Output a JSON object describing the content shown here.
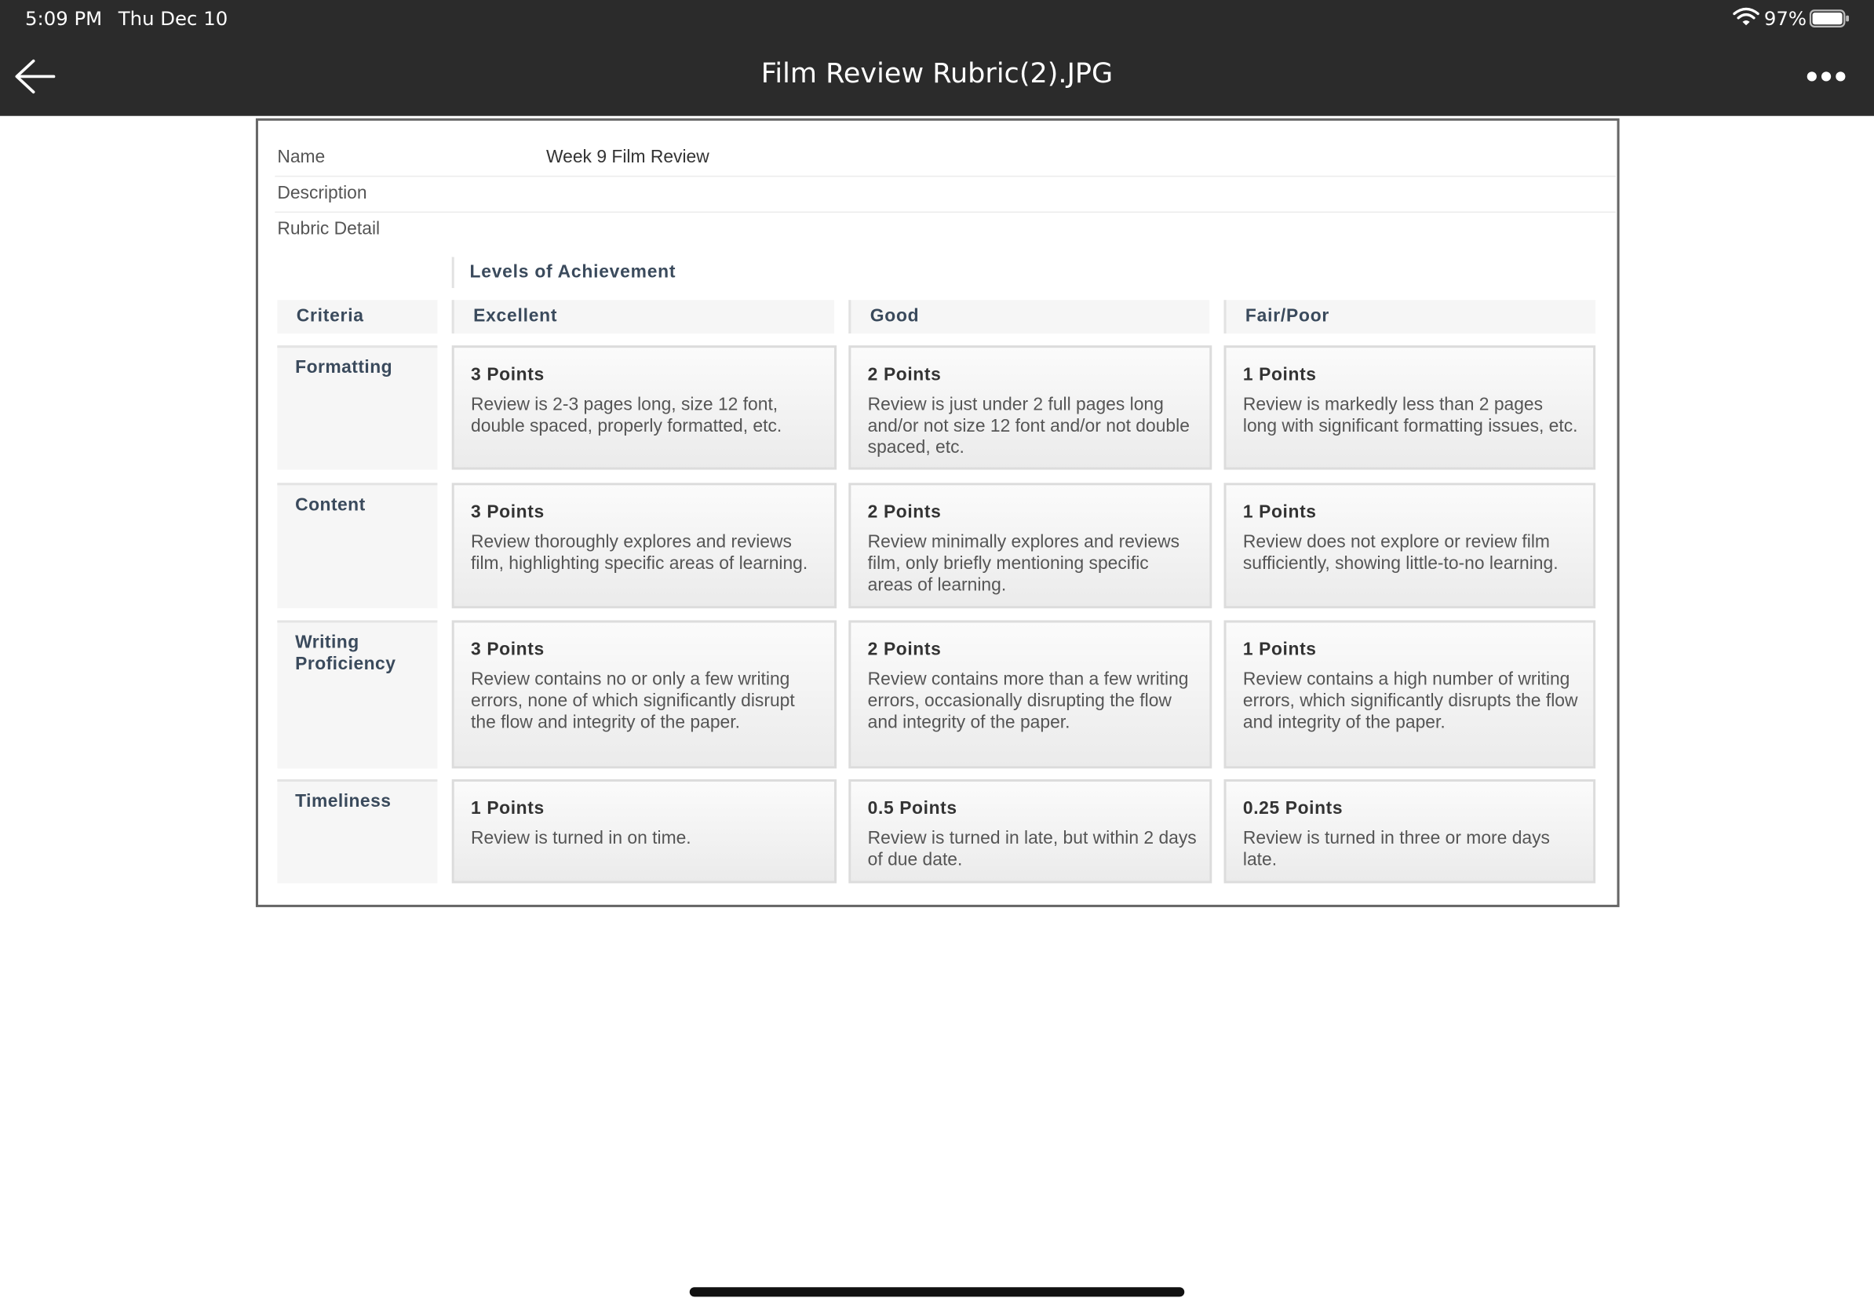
{
  "status": {
    "time": "5:09 PM",
    "date": "Thu Dec 10",
    "battery_pct": "97%"
  },
  "header": {
    "title": "Film Review Rubric(2).JPG",
    "back_icon": "arrow-left-icon",
    "more_icon": "ellipsis-icon"
  },
  "rubric": {
    "meta": {
      "name_label": "Name",
      "name_value": "Week 9 Film Review",
      "description_label": "Description",
      "detail_label": "Rubric Detail"
    },
    "levels_title": "Levels of Achievement",
    "criteria_header": "Criteria",
    "levels": [
      "Excellent",
      "Good",
      "Fair/Poor"
    ],
    "rows": [
      {
        "criterion": "Formatting",
        "cells": [
          {
            "points": "3 Points",
            "desc": "Review is 2-3 pages long, size 12 font, double spaced, properly formatted, etc."
          },
          {
            "points": "2 Points",
            "desc": "Review is just under 2 full pages long and/or not size 12 font and/or not double spaced, etc."
          },
          {
            "points": "1 Points",
            "desc": "Review is markedly less than 2 pages long with significant formatting issues, etc."
          }
        ]
      },
      {
        "criterion": "Content",
        "cells": [
          {
            "points": "3 Points",
            "desc": "Review thoroughly explores and reviews film, highlighting specific areas of learning."
          },
          {
            "points": "2 Points",
            "desc": "Review minimally explores and reviews film, only briefly mentioning specific areas of learning."
          },
          {
            "points": "1 Points",
            "desc": "Review does not explore or review film sufficiently, showing little-to-no learning."
          }
        ]
      },
      {
        "criterion": "Writing Proficiency",
        "cells": [
          {
            "points": "3 Points",
            "desc": "Review contains no or only a few writing errors, none of which significantly disrupt the flow and integrity of the paper."
          },
          {
            "points": "2 Points",
            "desc": "Review contains more than a few writing errors, occasionally disrupting the flow and integrity of the paper."
          },
          {
            "points": "1 Points",
            "desc": "Review contains a high number of writing errors, which significantly disrupts the flow and integrity of the paper."
          }
        ]
      },
      {
        "criterion": "Timeliness",
        "cells": [
          {
            "points": "1 Points",
            "desc": "Review is turned in on time."
          },
          {
            "points": "0.5 Points",
            "desc": "Review is turned in late, but within 2 days of due date."
          },
          {
            "points": "0.25 Points",
            "desc": "Review is turned in three or more days late."
          }
        ]
      }
    ]
  }
}
